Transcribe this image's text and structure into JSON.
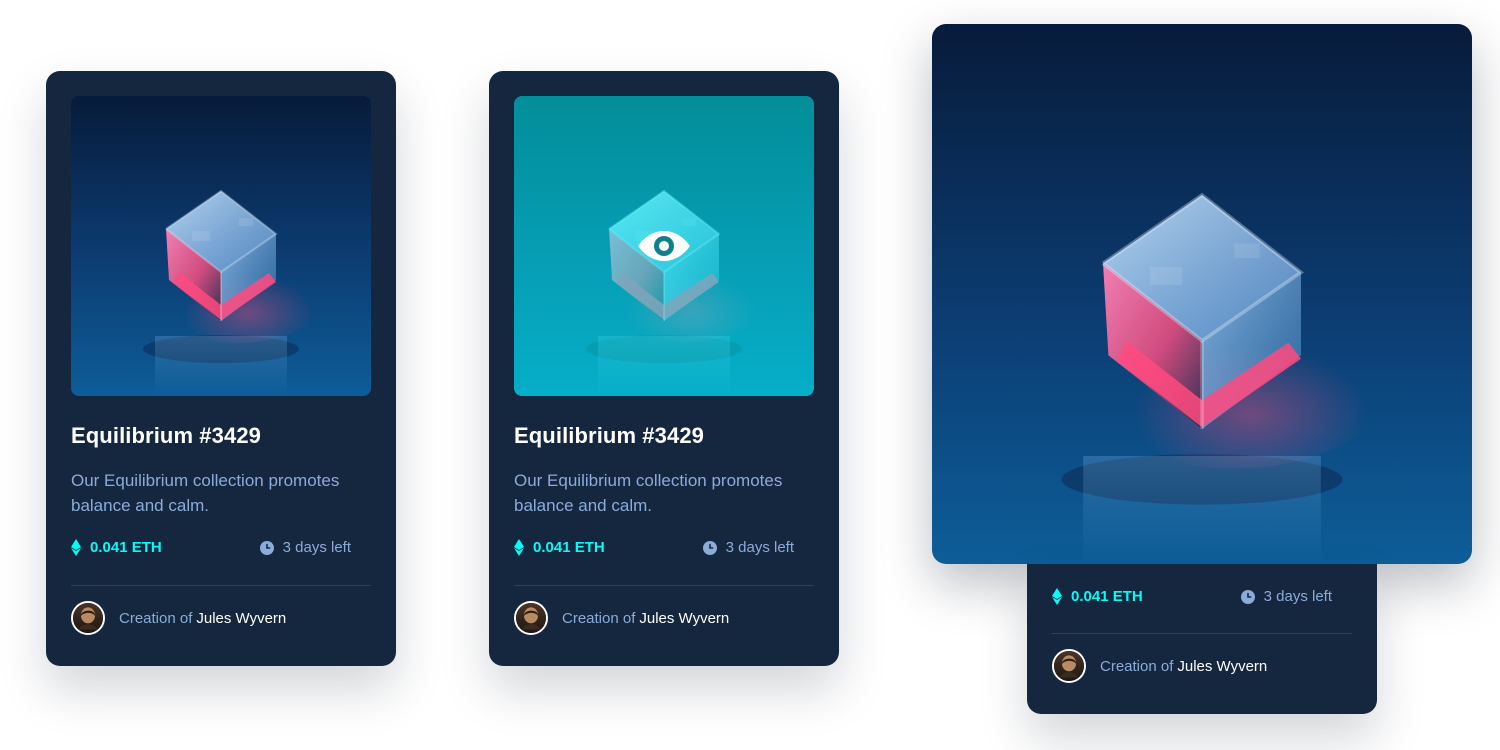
{
  "colors": {
    "card_background": "#15263f",
    "accent_cyan": "#00fff8",
    "soft_blue": "#8bacd9",
    "white": "#ffffff",
    "divider": "#2e405a"
  },
  "card": {
    "title": "Equilibrium #3429",
    "description": "Our Equilibrium collection promotes balance and calm.",
    "price": "0.041 ETH",
    "time_left": "3 days left",
    "creator_prefix": "Creation of",
    "creator_name": "Jules Wyvern"
  },
  "icons": {
    "price": "ethereum-icon",
    "time": "clock-icon",
    "overlay": "eye-icon",
    "avatar": "creator-avatar"
  }
}
